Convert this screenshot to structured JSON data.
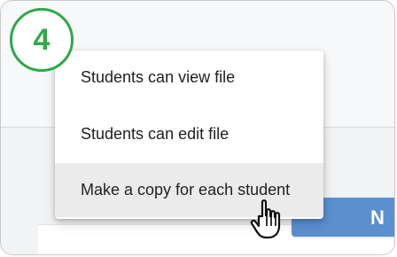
{
  "step_badge": {
    "number": "4",
    "color": "#2fa849"
  },
  "menu": {
    "items": [
      {
        "label": "Students can view file",
        "highlighted": false
      },
      {
        "label": "Students can edit file",
        "highlighted": false
      },
      {
        "label": "Make a copy for each student",
        "highlighted": true
      }
    ]
  },
  "background_button": {
    "visible_text": "N",
    "color": "#5b8fcf"
  },
  "cursor": {
    "icon": "hand-pointer-icon"
  }
}
